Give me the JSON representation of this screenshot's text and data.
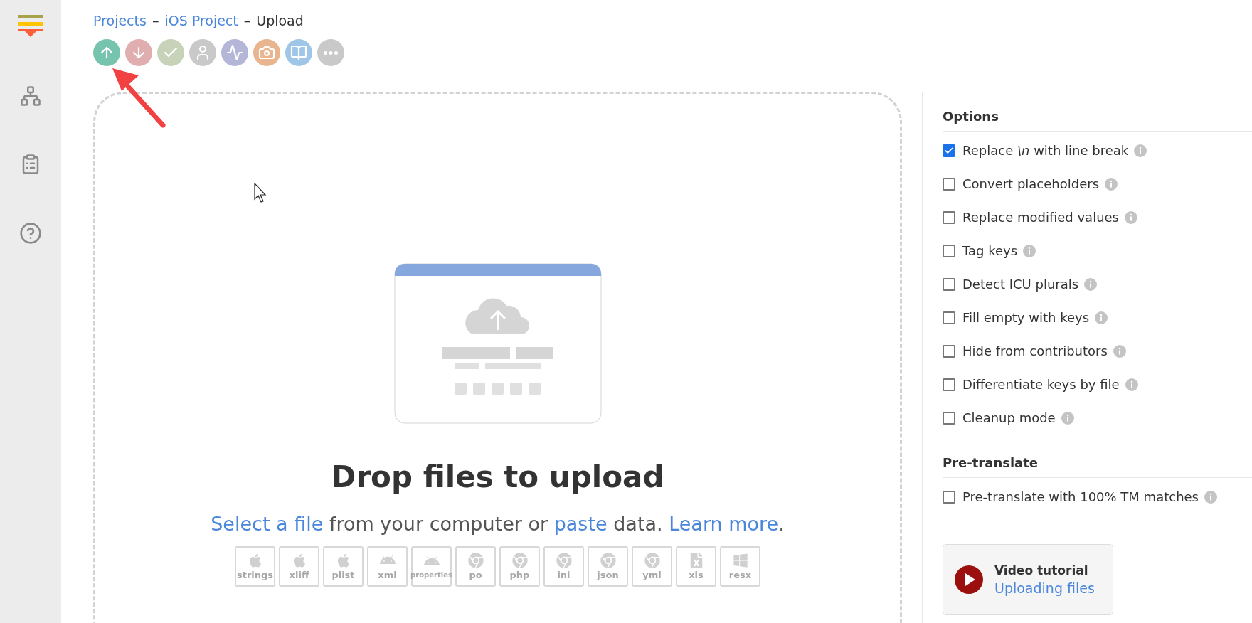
{
  "breadcrumb": [
    {
      "label": "Projects",
      "link": true
    },
    {
      "label": "iOS Project",
      "link": true
    },
    {
      "label": "Upload",
      "link": false
    }
  ],
  "breadcrumb_separator": "–",
  "toolbar": [
    {
      "kind": "upload",
      "color": "#76c4ad"
    },
    {
      "kind": "download",
      "color": "#e0aeae"
    },
    {
      "kind": "check",
      "color": "#c6d3b8"
    },
    {
      "kind": "user",
      "color": "#c9c9c9"
    },
    {
      "kind": "activity",
      "color": "#b3b6d6"
    },
    {
      "kind": "camera",
      "color": "#e9b58e"
    },
    {
      "kind": "book",
      "color": "#9fc6e6"
    },
    {
      "kind": "more",
      "color": "#c9c9c9"
    }
  ],
  "dropzone": {
    "title": "Drop files to upload",
    "subtitle": [
      {
        "kind": "link",
        "text": "Select a file"
      },
      {
        "kind": "text",
        "text": " from your computer or "
      },
      {
        "kind": "link",
        "text": "paste"
      },
      {
        "kind": "text",
        "text": " data. "
      },
      {
        "kind": "link",
        "text": "Learn more"
      },
      {
        "kind": "text",
        "text": "."
      }
    ],
    "formats": [
      {
        "label": "strings",
        "kind": "apple"
      },
      {
        "label": "xliff",
        "kind": "apple"
      },
      {
        "label": "plist",
        "kind": "apple"
      },
      {
        "label": "xml",
        "kind": "android"
      },
      {
        "label": "properties",
        "kind": "android"
      },
      {
        "label": "po",
        "kind": "chrome"
      },
      {
        "label": "php",
        "kind": "chrome"
      },
      {
        "label": "ini",
        "kind": "chrome"
      },
      {
        "label": "json",
        "kind": "chrome"
      },
      {
        "label": "yml",
        "kind": "chrome"
      },
      {
        "label": "xls",
        "kind": "excel"
      },
      {
        "label": "resx",
        "kind": "windows"
      }
    ]
  },
  "options": {
    "title": "Options",
    "items": [
      {
        "label": "Replace *\\n* with line break",
        "checked": true
      },
      {
        "label": "Convert placeholders",
        "checked": false
      },
      {
        "label": "Replace modified values",
        "checked": false
      },
      {
        "label": "Tag keys",
        "checked": false
      },
      {
        "label": "Detect ICU plurals",
        "checked": false
      },
      {
        "label": "Fill empty with keys",
        "checked": false
      },
      {
        "label": "Hide from contributors",
        "checked": false
      },
      {
        "label": "Differentiate keys by file",
        "checked": false
      },
      {
        "label": "Cleanup mode",
        "checked": false
      }
    ]
  },
  "pretranslate": {
    "title": "Pre-translate",
    "items": [
      {
        "label": "Pre-translate with 100% TM matches",
        "checked": false
      }
    ]
  },
  "video": {
    "title": "Video tutorial",
    "link": "Uploading files"
  }
}
